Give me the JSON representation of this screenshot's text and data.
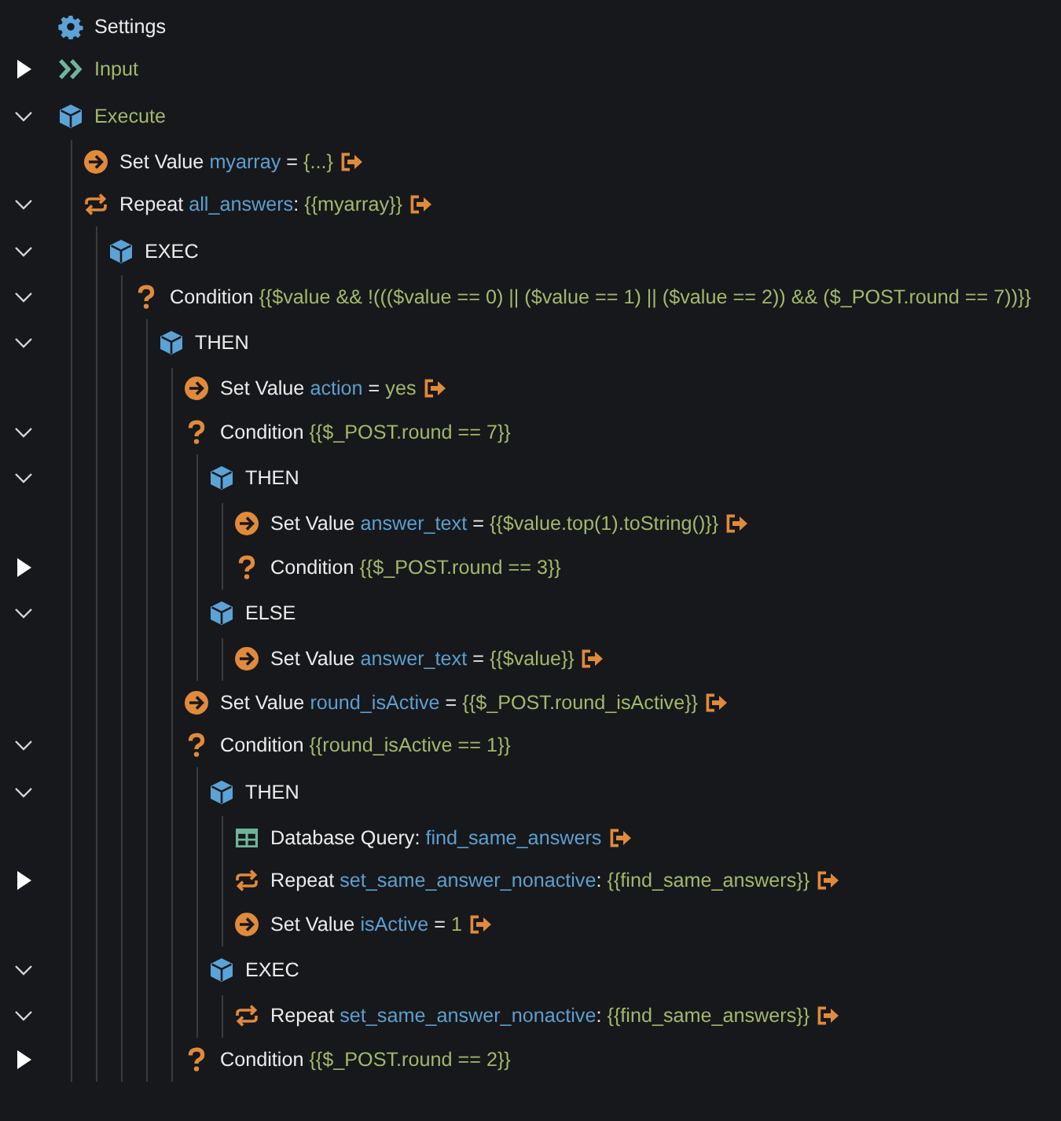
{
  "tree": [
    {
      "kind": "gear",
      "parts": [
        {
          "kind": "plain",
          "text": "Settings"
        }
      ],
      "link": false
    },
    {
      "kind": "chevrons",
      "parts": [
        {
          "kind": "heading",
          "text": "Input"
        }
      ],
      "link": false,
      "expanded": false
    },
    {
      "kind": "cube",
      "parts": [
        {
          "kind": "heading",
          "text": "Execute"
        }
      ],
      "link": false,
      "expanded": true,
      "children": [
        {
          "kind": "set_value",
          "parts": [
            {
              "kind": "plain",
              "text": "Set Value "
            },
            {
              "kind": "name",
              "text": "myarray"
            },
            {
              "kind": "plain",
              "text": " = "
            },
            {
              "kind": "value",
              "text": "{...}"
            }
          ],
          "link": true
        },
        {
          "kind": "repeat",
          "parts": [
            {
              "kind": "plain",
              "text": "Repeat "
            },
            {
              "kind": "name",
              "text": "all_answers"
            },
            {
              "kind": "plain",
              "text": ": "
            },
            {
              "kind": "value",
              "text": "{{myarray}}"
            }
          ],
          "link": true,
          "expanded": true,
          "children": [
            {
              "kind": "cube",
              "parts": [
                {
                  "kind": "plain",
                  "text": "EXEC"
                }
              ],
              "link": false,
              "expanded": true,
              "children": [
                {
                  "kind": "condition",
                  "parts": [
                    {
                      "kind": "plain",
                      "text": "Condition "
                    },
                    {
                      "kind": "value",
                      "text": "{{$value && !((($value == 0) || ($value == 1) || ($value == 2)) && ($_POST.round == 7))}}"
                    }
                  ],
                  "link": false,
                  "expanded": true,
                  "children": [
                    {
                      "kind": "cube",
                      "parts": [
                        {
                          "kind": "plain",
                          "text": "THEN"
                        }
                      ],
                      "link": false,
                      "expanded": true,
                      "children": [
                        {
                          "kind": "set_value",
                          "parts": [
                            {
                              "kind": "plain",
                              "text": "Set Value "
                            },
                            {
                              "kind": "name",
                              "text": "action"
                            },
                            {
                              "kind": "plain",
                              "text": " = "
                            },
                            {
                              "kind": "value",
                              "text": "yes"
                            }
                          ],
                          "link": true
                        },
                        {
                          "kind": "condition",
                          "parts": [
                            {
                              "kind": "plain",
                              "text": "Condition "
                            },
                            {
                              "kind": "value",
                              "text": "{{$_POST.round == 7}}"
                            }
                          ],
                          "link": false,
                          "expanded": true,
                          "children": [
                            {
                              "kind": "cube",
                              "parts": [
                                {
                                  "kind": "plain",
                                  "text": "THEN"
                                }
                              ],
                              "link": false,
                              "expanded": true,
                              "children": [
                                {
                                  "kind": "set_value",
                                  "parts": [
                                    {
                                      "kind": "plain",
                                      "text": "Set Value "
                                    },
                                    {
                                      "kind": "name",
                                      "text": "answer_text"
                                    },
                                    {
                                      "kind": "plain",
                                      "text": " = "
                                    },
                                    {
                                      "kind": "value",
                                      "text": "{{$value.top(1).toString()}}"
                                    }
                                  ],
                                  "link": true
                                },
                                {
                                  "kind": "condition",
                                  "parts": [
                                    {
                                      "kind": "plain",
                                      "text": "Condition "
                                    },
                                    {
                                      "kind": "value",
                                      "text": "{{$_POST.round == 3}}"
                                    }
                                  ],
                                  "link": false,
                                  "expanded": false
                                }
                              ]
                            },
                            {
                              "kind": "cube",
                              "parts": [
                                {
                                  "kind": "plain",
                                  "text": "ELSE"
                                }
                              ],
                              "link": false,
                              "expanded": true,
                              "children": [
                                {
                                  "kind": "set_value",
                                  "parts": [
                                    {
                                      "kind": "plain",
                                      "text": "Set Value "
                                    },
                                    {
                                      "kind": "name",
                                      "text": "answer_text"
                                    },
                                    {
                                      "kind": "plain",
                                      "text": " = "
                                    },
                                    {
                                      "kind": "value",
                                      "text": "{{$value}}"
                                    }
                                  ],
                                  "link": true
                                }
                              ]
                            }
                          ]
                        },
                        {
                          "kind": "set_value",
                          "parts": [
                            {
                              "kind": "plain",
                              "text": "Set Value "
                            },
                            {
                              "kind": "name",
                              "text": "round_isActive"
                            },
                            {
                              "kind": "plain",
                              "text": " = "
                            },
                            {
                              "kind": "value",
                              "text": "{{$_POST.round_isActive}}"
                            }
                          ],
                          "link": true
                        },
                        {
                          "kind": "condition",
                          "parts": [
                            {
                              "kind": "plain",
                              "text": "Condition "
                            },
                            {
                              "kind": "value",
                              "text": "{{round_isActive == 1}}"
                            }
                          ],
                          "link": false,
                          "expanded": true,
                          "children": [
                            {
                              "kind": "cube",
                              "parts": [
                                {
                                  "kind": "plain",
                                  "text": "THEN"
                                }
                              ],
                              "link": false,
                              "expanded": true,
                              "children": [
                                {
                                  "kind": "table",
                                  "parts": [
                                    {
                                      "kind": "plain",
                                      "text": "Database Query: "
                                    },
                                    {
                                      "kind": "name",
                                      "text": "find_same_answers"
                                    }
                                  ],
                                  "link": true
                                },
                                {
                                  "kind": "repeat",
                                  "parts": [
                                    {
                                      "kind": "plain",
                                      "text": "Repeat "
                                    },
                                    {
                                      "kind": "name",
                                      "text": "set_same_answer_nonactive"
                                    },
                                    {
                                      "kind": "plain",
                                      "text": ": "
                                    },
                                    {
                                      "kind": "value",
                                      "text": "{{find_same_answers}}"
                                    }
                                  ],
                                  "link": true,
                                  "expanded": false
                                },
                                {
                                  "kind": "set_value",
                                  "parts": [
                                    {
                                      "kind": "plain",
                                      "text": "Set Value "
                                    },
                                    {
                                      "kind": "name",
                                      "text": "isActive"
                                    },
                                    {
                                      "kind": "plain",
                                      "text": " = "
                                    },
                                    {
                                      "kind": "value",
                                      "text": "1"
                                    }
                                  ],
                                  "link": true
                                }
                              ]
                            },
                            {
                              "kind": "cube",
                              "parts": [
                                {
                                  "kind": "plain",
                                  "text": "EXEC"
                                }
                              ],
                              "link": false,
                              "expanded": true,
                              "children": [
                                {
                                  "kind": "repeat",
                                  "parts": [
                                    {
                                      "kind": "plain",
                                      "text": "Repeat "
                                    },
                                    {
                                      "kind": "name",
                                      "text": "set_same_answer_nonactive"
                                    },
                                    {
                                      "kind": "plain",
                                      "text": ": "
                                    },
                                    {
                                      "kind": "value",
                                      "text": "{{find_same_answers}}"
                                    }
                                  ],
                                  "link": true,
                                  "expanded": true
                                }
                              ]
                            }
                          ]
                        },
                        {
                          "kind": "condition",
                          "parts": [
                            {
                              "kind": "plain",
                              "text": "Condition "
                            },
                            {
                              "kind": "value",
                              "text": "{{$_POST.round == 2}}"
                            }
                          ],
                          "link": false,
                          "expanded": false
                        }
                      ]
                    }
                  ]
                }
              ]
            }
          ]
        }
      ]
    }
  ]
}
